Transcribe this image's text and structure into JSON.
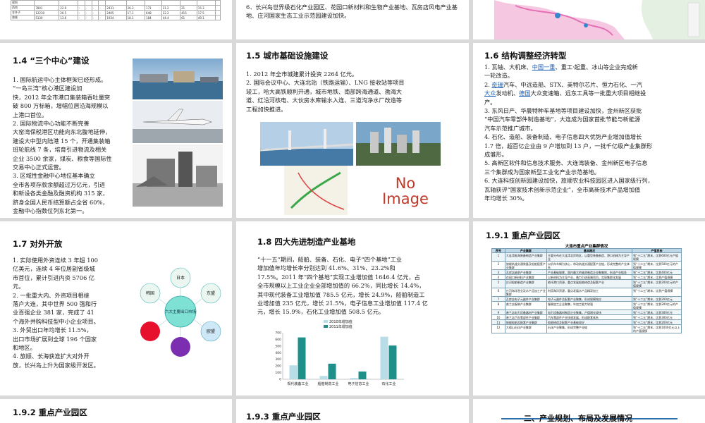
{
  "slides": {
    "s_top_left": {
      "table_rows": [
        [
          "规划",
          "",
          "",
          "",
          "",
          "",
          "",
          "",
          "",
          "",
          "",
          "",
          "",
          ""
        ],
        [
          "西岗",
          "7801",
          "22.9",
          "-",
          "-",
          "-",
          "-",
          "2431",
          "26.3",
          "171",
          "21.2",
          "21",
          "15.3",
          ""
        ],
        [
          "甘井子",
          "12230",
          "20.5",
          "-",
          "-",
          "-",
          "-",
          "2405",
          "17.1",
          "648",
          "22.2",
          "415",
          "17.5",
          ""
        ],
        [
          "旅顺",
          "5130",
          "13.6",
          "-",
          "-",
          "-",
          "-",
          "1934",
          "18.1",
          "184",
          "44.4",
          "61",
          "49.1",
          ""
        ]
      ]
    },
    "s_top_mid": {
      "lines": "6．长兴岛世界级石化产业园区、花园口新材料和生物产业基地、瓦房店风电产业基地、庄河国家生态工业示范园建设加快。"
    },
    "s_1_4": {
      "title": "1.4 “三个中心”建设",
      "text": "1. 国际航运中心主体框架已经形成。\n“一岛三湾”核心港区建设加\n快，2012 年全市港口集装箱吞吐量突\n破 800 万标箱，增幅位居沿海规模以\n上港口首位。\n2. 国际物流中心功能不断完善\n大窑湾保税港区功能向东北腹地延伸，\n建设大中型内陆港 15 个，开通集装箱\n班轮航线 7 条，培育引进物流及相关\n企业 3500 余家，煤炭、粮食等国际性\n交易中心正式运营。\n3. 区域性金融中心地位基本确立\n全市各项存款余额超过万亿元，引进\n和新设各类金融及融资机构 315 家，\n跻身全国人民币结算额占全省 60%，\n金融中心指数位列东北第一。"
    },
    "s_1_5": {
      "title": "1.5 城市基础设施建设",
      "text": "1. 2012 年全市城建累计投资 2264 亿元。\n2. 国际会议中心、大连北站（铁路运输）、LNG 接收站等项目\n竣工，哈大高铁顺利开通，城市地铁、南部跨海通道、渤海大\n道、红沿河核电、大伙房水库输水入连、三道沟净水厂改造等\n工程加快推进。",
      "no_image_line1": "No",
      "no_image_line2": "Image"
    },
    "s_1_6": {
      "title": "1.6 结构调整经济转型",
      "p1_a": "1. 瓦轴、大机床、",
      "p1_link": "中国一重",
      "p1_b": "、重工·起重、冰山等企业完成新\n一轮改造。",
      "p2_a": "2. ",
      "p2_link1": "奇瑞",
      "p2_b": "汽车、中远造船、STX、英特尔芯片、恒力石化、一汽\n",
      "p2_link2": "大众",
      "p2_c": "发动机、",
      "p2_link3": "德国",
      "p2_d": "大众变速箱、远东工具等一批重大项目相继投\n产。",
      "p3": "3. 东风日产、华晨特种车基地等项目建设加快，金州新区获批\n“中国汽车零部件制造基地”，大连成为国家首批节能与新能源\n汽车示范推广城市。\n4. 石化、造船、装备制造、电子信息四大优势产业增加值增长\n1.7 倍，超百亿企业由 9 户增加到 13 户，一批千亿级产业集群形\n成雏形。\n5. 高新区软件和信息技术服务、大连湾装备、金州新区电子信息\n三个集群成为国家新型工业化产业示范基地。\n6. 大连科技创新园建设加快，旅顺农业科技园区进入国家级行列，\n瓦轴获评“国家技术创新示范企业”，全市高新技术产品增加值\n年均增长 30%。"
    },
    "s_1_7": {
      "title": "1.7 对外开放",
      "text": "1. 实际使用外资连续 3 年超 100\n亿美元，连续 4 年位居副省级城\n市首位，累计引进内资 5706 亿\n元。\n2. 一批重大内、外资项目相继\n落户大连，其中世界 500 强和行\n业百强企业 381 家，完成了 41\n个海外并购科技型中小企业项目。\n3. 外贸出口年均增长 11.5%，\n出口市场扩展到全球 196 个国家\n和地区。\n4. 旅顺、长海获准扩大对外开\n放，长兴岛上升为国家级开发区。",
      "center_label": "六大主要出口市场",
      "nodes": [
        "日本",
        "东盟",
        "欧盟",
        "",
        "",
        "韩国"
      ]
    },
    "s_1_8": {
      "title": "1.8 四大先进制造产业基地",
      "text": "“十一五”期间，船舶、装备、石化、电子“四个基地”工业\n增加值年均增长率分别达到 41.6%、31%、23.2%和\n17.5%。2011 年“四个基地”实现工业增加值 1646.4 亿元，占\n全市规模以上工业企业全部增加值的 66.2%，同比增长 14.4%，\n其中现代装备工业增加值 785.5 亿元，增长 24.9%，船舶制造工\n业增加值 235 亿元，增长 21.5%，电子信息工业增加值 117.4 亿\n元，增长 15.9%，石化工业增加值 508.5 亿元。"
    },
    "s_1_9_1": {
      "title": "1.9.1 重点产业园区",
      "table_title": "大连市重点产业集群情况",
      "headers": [
        "序号",
        "产业集群",
        "基本概况",
        "产值目标"
      ],
      "rows": [
        [
          "1",
          "大连湾临海装备制造产业集群",
          "主要分布在大连湾北岸地区，以重型装备制造、港口机械为主导产业",
          "到“十二五”期末，比到600亿元产值规模"
        ],
        [
          "2",
          "旅顺轨道交通装备及船舶配套产业集群",
          "以机车车辆为核心，带动轨道交通配套产业链，形成完整的产业体系",
          "到“十二五”期末，比到500亿元的产值规模"
        ],
        [
          "3",
          "瓦房店轴承产业集群",
          "产业基础雄厚，国内最大的轴承制造企业聚集地，形成产业链条",
          "到“十二五”期末，比到400亿元"
        ],
        [
          "4",
          "花园口新材料产业集群",
          "以新材料为主导产业，着力引进高端项目，实现集群化发展",
          "到“十二五”期末，比到产值规模"
        ],
        [
          "5",
          "庄河船舶制造产业集群",
          "依托港口资源，重点发展船舶修造及配套产业",
          "到“十二五”期末，比到200亿元的产值规模"
        ],
        [
          "6",
          "庄河海洋渔业及水产品加工产业集群",
          "利用海洋资源，重点发展水产品精深加工",
          "到“十二五”期末，比到产值规模"
        ],
        [
          "7",
          "瓦房店电子元器件产业集群",
          "电子元器件及配套产业聚集，形成规模效应",
          "到“十二五”期末，比到200亿元"
        ],
        [
          "8",
          "普兰店服装产业集群",
          "服装加工企业聚集，年加工能力较强",
          "到“十二五”期末，比到200亿元的产值规模"
        ],
        [
          "9",
          "普兰店电力设备器材产业集群",
          "电力设备器材制造企业聚集，产值增长较快",
          "到“十二五”期末，比到300亿元"
        ],
        [
          "10",
          "普兰店汽车零部件产业集群",
          "汽车零部件产业快速发展，形成配套体系",
          "到“十二五”期末，比到300亿元"
        ],
        [
          "11",
          "旅顺船舶及配套产业集群",
          "船舶修造及配套产业基础较好",
          "到“十二五”期末，比到200亿元"
        ],
        [
          "12",
          "大孤山石化产业集群",
          "石化产业聚集，形成完整产业链",
          "到“十二五”期末，比到1000亿元以上的产值规模"
        ]
      ]
    },
    "s_1_9_2": {
      "title": "1.9.2 重点产业园区"
    },
    "s_1_9_3": {
      "title": "1.9.3 重点产业园区"
    },
    "s_2": {
      "title": "二、产业规划、布局及发展情况"
    }
  },
  "chart_data": {
    "type": "bar",
    "categories": [
      "现代装备工业",
      "船舶制造工业",
      "电子信息工业",
      "石化工业"
    ],
    "series": [
      {
        "name": "2010年增加值",
        "values": [
          210,
          50,
          20,
          640
        ]
      },
      {
        "name": "2011年增加值",
        "values": [
          630,
          235,
          117,
          508
        ]
      }
    ],
    "ylim": [
      0,
      700
    ],
    "yticks": [
      "0",
      "100",
      "200",
      "300",
      "400",
      "500",
      "600",
      "700"
    ],
    "legend_position": "top",
    "colors": {
      "2010年增加值": "#b9dde7",
      "2011年增加值": "#1f8f8a"
    },
    "grid": false
  }
}
